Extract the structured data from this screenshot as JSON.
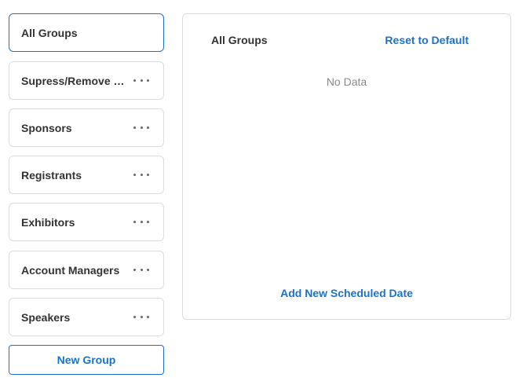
{
  "sidebar": {
    "groups": [
      {
        "label": "All Groups",
        "selected": true,
        "has_menu": false
      },
      {
        "label": "Supress/Remove p...",
        "selected": false,
        "has_menu": true
      },
      {
        "label": "Sponsors",
        "selected": false,
        "has_menu": true
      },
      {
        "label": "Registrants",
        "selected": false,
        "has_menu": true
      },
      {
        "label": "Exhibitors",
        "selected": false,
        "has_menu": true
      },
      {
        "label": "Account Managers",
        "selected": false,
        "has_menu": true
      },
      {
        "label": "Speakers",
        "selected": false,
        "has_menu": true
      }
    ],
    "new_group_label": "New Group",
    "menu_icon": "more-horizontal-icon"
  },
  "panel": {
    "title": "All Groups",
    "reset_label": "Reset to Default",
    "empty_text": "No Data",
    "add_date_label": "Add New Scheduled Date"
  },
  "colors": {
    "accent": "#1a73c8",
    "border": "#dcdcdc",
    "text": "#333333",
    "muted": "#888888"
  }
}
